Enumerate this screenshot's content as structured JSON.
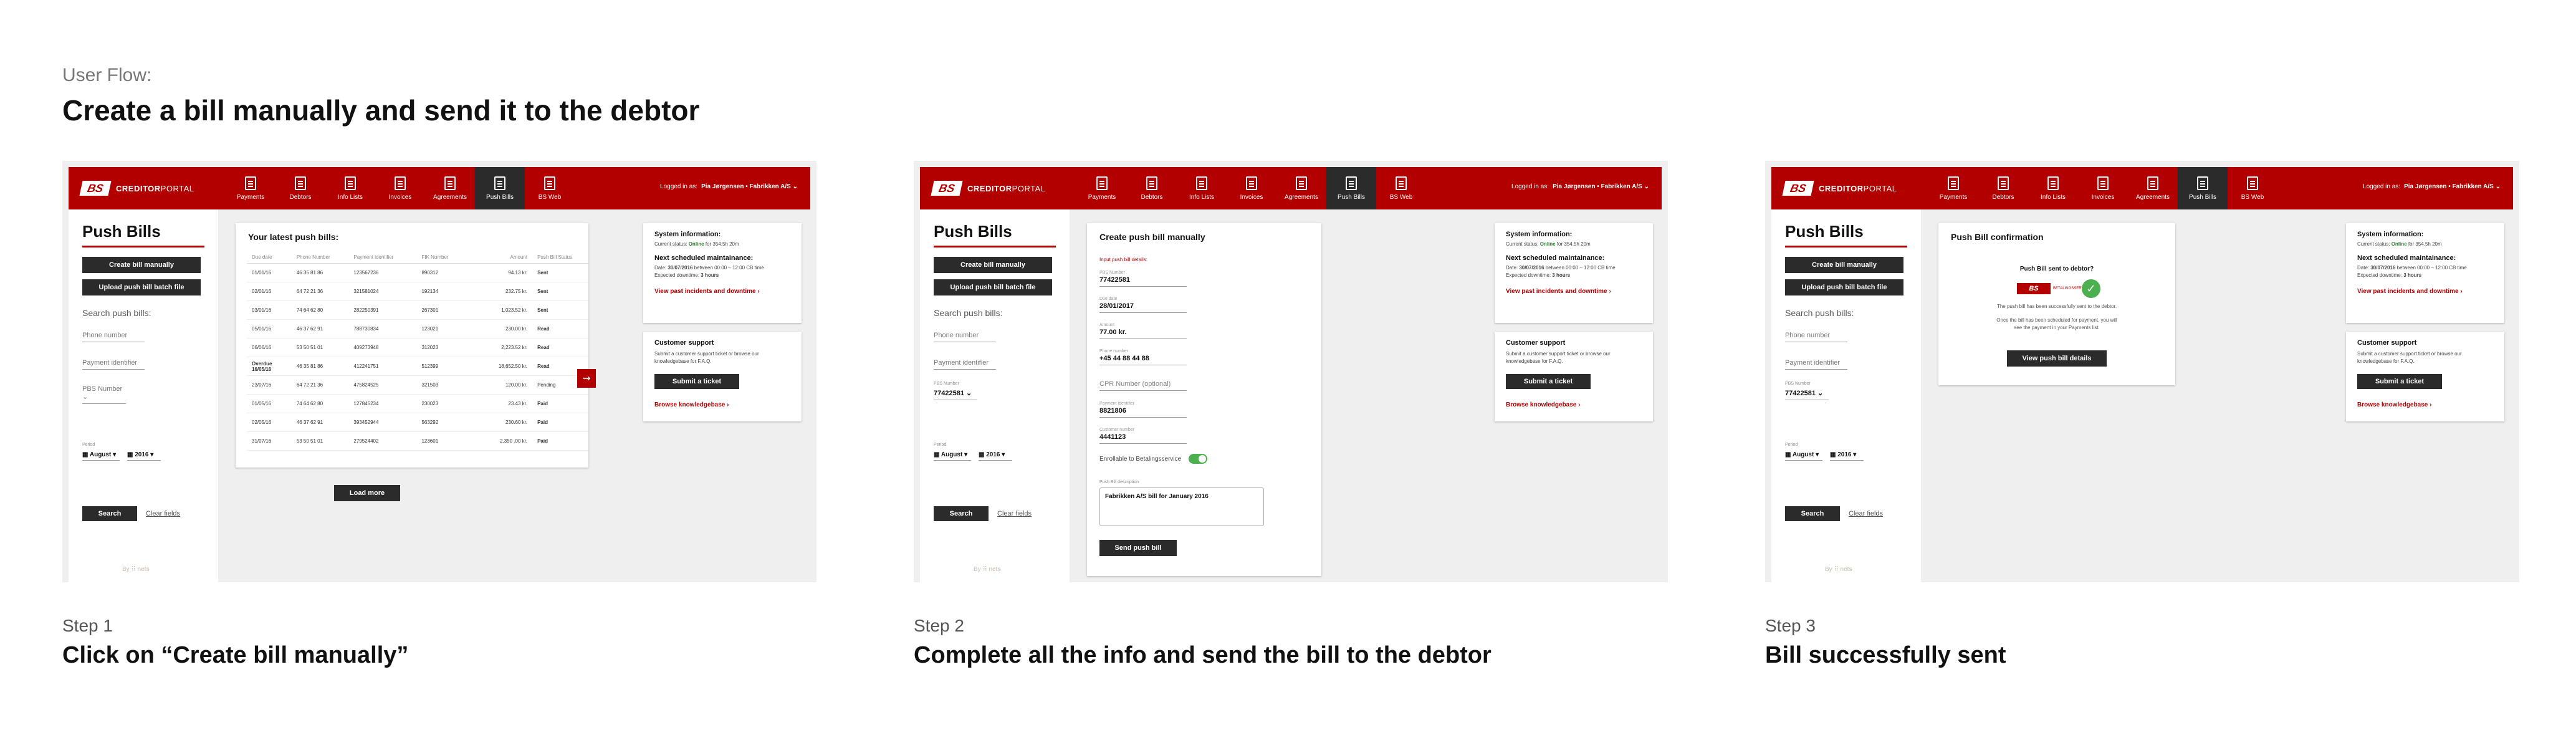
{
  "flow": {
    "label": "User Flow:",
    "title": "Create a bill manually and send it to the debtor"
  },
  "app": {
    "logo_mark": "BS",
    "logo_bold": "CREDITOR",
    "logo_light": "PORTAL",
    "nav": [
      "Payments",
      "Debtors",
      "Info Lists",
      "Invoices",
      "Agreements",
      "Push Bills",
      "BS Web"
    ],
    "active_nav": "Push Bills",
    "login_prefix": "Logged in as:",
    "login_user": "Pia Jørgensen • Fabrikken A/S ⌄",
    "by_nets": "By ⠿ nets"
  },
  "sidebar": {
    "title": "Push Bills",
    "create_btn": "Create bill manually",
    "upload_btn": "Upload push bill batch file",
    "search_label": "Search push bills:",
    "phone_ph": "Phone number",
    "payment_ph": "Payment identifier",
    "pbs_ph": "PBS Number ⌄",
    "pbs_label": "PBS Number",
    "pbs_value": "77422581 ⌄",
    "period_label": "Period",
    "month": "August",
    "year": "2016",
    "search_btn": "Search",
    "clear": "Clear fields"
  },
  "steps": [
    {
      "label": "Step 1",
      "title": "Click on “Create bill manually”"
    },
    {
      "label": "Step 2",
      "title": "Complete all the info and send the bill to the debtor"
    },
    {
      "label": "Step 3",
      "title": "Bill successfully sent"
    }
  ],
  "latest": {
    "title": "Your latest push bills:",
    "columns": [
      "Due date",
      "Phone Number",
      "Payment identifier",
      "FIK Number",
      "Amount",
      "Push Bill Status"
    ],
    "rows": [
      {
        "due": "01/01/16",
        "phone": "46 35 81 86",
        "pid": "123567236",
        "fik": "890312",
        "amount": "94.13 kr.",
        "status": "Sent",
        "cls": "st-sent"
      },
      {
        "due": "02/01/16",
        "phone": "64 72 21 36",
        "pid": "321581024",
        "fik": "192134",
        "amount": "232.75 kr.",
        "status": "Sent",
        "cls": "st-sent"
      },
      {
        "due": "03/01/16",
        "phone": "74 64 62 80",
        "pid": "282250391",
        "fik": "267301",
        "amount": "1,023.52 kr.",
        "status": "Sent",
        "cls": "st-sent"
      },
      {
        "due": "05/01/16",
        "phone": "46 37 62 91",
        "pid": "788730834",
        "fik": "123021",
        "amount": "230.00 kr.",
        "status": "Read",
        "cls": "st-read"
      },
      {
        "due": "06/06/16",
        "phone": "53 50 51 01",
        "pid": "409273948",
        "fik": "312023",
        "amount": "2,223.52 kr.",
        "status": "Read",
        "cls": "st-read"
      },
      {
        "due": "Overdue 16/05/16",
        "phone": "46 35 81 86",
        "pid": "412241751",
        "fik": "512399",
        "amount": "18,652.50 kr.",
        "status": "Read",
        "cls": "st-read",
        "overdue": true
      },
      {
        "due": "23/07/16",
        "phone": "64 72 21 36",
        "pid": "475824525",
        "fik": "321503",
        "amount": "120.00 kr.",
        "status": "Pending",
        "cls": "st-pending"
      },
      {
        "due": "01/05/16",
        "phone": "74 64 62 80",
        "pid": "127845234",
        "fik": "230023",
        "amount": "23.43 kr.",
        "status": "Paid",
        "cls": "st-paid"
      },
      {
        "due": "02/05/16",
        "phone": "46 37 62 91",
        "pid": "393452944",
        "fik": "563292",
        "amount": "230.60 kr.",
        "status": "Paid",
        "cls": "st-paid"
      },
      {
        "due": "31/07/16",
        "phone": "53 50 51 01",
        "pid": "279524402",
        "fik": "123601",
        "amount": "2,350 .00 kr.",
        "status": "Paid",
        "cls": "st-paid"
      }
    ],
    "load_more": "Load more",
    "arrow": "⇝"
  },
  "system": {
    "title": "System information:",
    "status_prefix": "Current status:",
    "status_value": "Online",
    "status_suffix": "for 354.5h 20m",
    "maint_title": "Next scheduled maintainance:",
    "maint_date_prefix": "Date:",
    "maint_date": "30/07/2016",
    "maint_between": "between 00:00 – 12:00 CB time",
    "maint_down_prefix": "Expected downtime:",
    "maint_down": "3 hours",
    "incidents": "View past incidents and downtime ›"
  },
  "support": {
    "title": "Customer support",
    "text": "Submit a customer support ticket or browse our knowledgebase for F.A.Q.",
    "btn": "Submit a ticket",
    "kb": "Browse knowledgebase ›"
  },
  "form": {
    "title": "Create push bill manually",
    "required": "Input push bill details:",
    "fields": [
      {
        "label": "PBS Number",
        "value": "77422581",
        "ph": false
      },
      {
        "label": "Due date",
        "value": "28/01/2017",
        "ph": false
      },
      {
        "label": "Amount",
        "value": "77.00 kr.",
        "ph": false
      },
      {
        "label": "Phone number",
        "value": "+45 44 88 44 88",
        "ph": false
      },
      {
        "label": "",
        "value": "CPR Number (optional)",
        "ph": true
      },
      {
        "label": "Payment identifier",
        "value": "8821806",
        "ph": false
      },
      {
        "label": "Customer number",
        "value": "4441123",
        "ph": false
      }
    ],
    "toggle_label": "Enrollable to Betalingsservice",
    "text_label": "Push Bill description",
    "text_value": "Fabrikken A/S bill for January 2016",
    "send_btn": "Send push bill"
  },
  "confirm": {
    "title": "Push Bill confirmation",
    "question": "Push Bill sent to debtor?",
    "logo": "BS",
    "logo_small": "BETALINGSSERVICE",
    "check": "✓",
    "msg1": "The push bill has been successfully sent to the debtor.",
    "msg2": "Once the bill has been scheduled for payment, you will see the payment in your Payments list.",
    "btn": "View push bill details"
  }
}
